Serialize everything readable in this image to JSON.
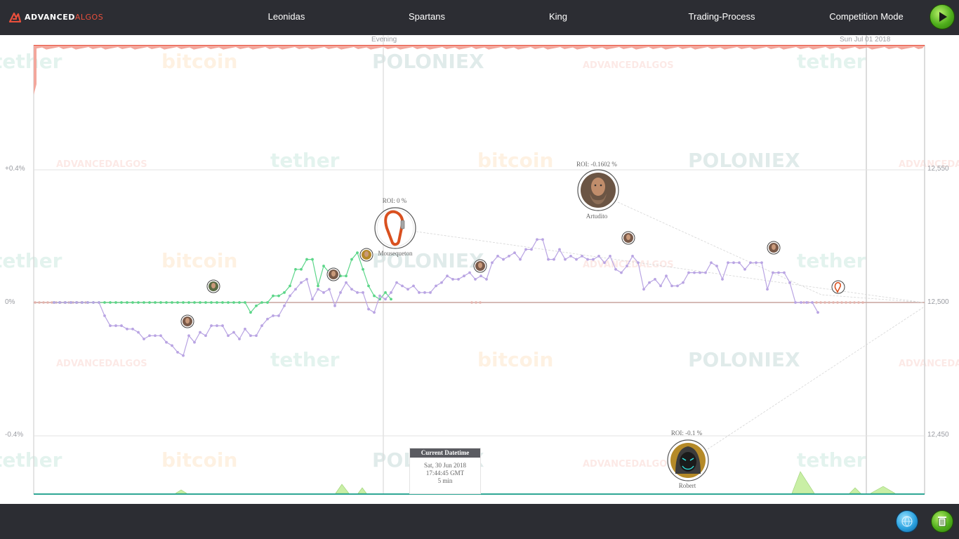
{
  "app": {
    "logo": {
      "part1": "ADVANCED",
      "part2": "ALGOS"
    },
    "nav": [
      {
        "label": "Leonidas"
      },
      {
        "label": "Spartans"
      },
      {
        "label": "King"
      },
      {
        "label": "Trading-Process"
      },
      {
        "label": "Competition Mode"
      }
    ],
    "play_icon": "play-icon",
    "bottom_buttons": [
      {
        "icon": "globe-icon"
      },
      {
        "icon": "trash-icon"
      }
    ],
    "colors": {
      "bar": "#2c2d33",
      "accent": "#e94f3c",
      "roi_line": "#b9a4e3",
      "green": "#5cd689",
      "baseline": "#c9a49e"
    }
  },
  "time_labels": {
    "period": "Evening",
    "date": "Sun Jul 01 2018"
  },
  "left_axis": [
    "+0.4%",
    "0%",
    "-0.4%"
  ],
  "right_axis": [
    "12,550",
    "12,500",
    "12,450"
  ],
  "current_datetime": {
    "title": "Current Datetime",
    "date": "Sat, 30 Jun 2018",
    "time": "17:44:45 GMT",
    "interval": "5 min"
  },
  "bots": [
    {
      "roi": "ROI: 0 %",
      "name": "Mousequeton",
      "icon": "carabiner-icon"
    },
    {
      "roi": "ROI: -0.1602 %",
      "name": "Artudito",
      "icon": "viking-avatar-icon"
    },
    {
      "roi": "ROI: -0.1 %",
      "name": "Robert",
      "icon": "hooded-mask-avatar-icon"
    }
  ],
  "watermarks": {
    "bitcoin": "bitcoin",
    "tether": "tether",
    "poloniex": "POLONIEX",
    "advanced": "ADVANCED",
    "algos": "ALGOS"
  },
  "chart_data": {
    "type": "line",
    "left_axis_ticks": [
      "+0.4%",
      "0%",
      "-0.4%"
    ],
    "right_axis_ticks": [
      12550,
      12500,
      12450
    ],
    "series": [
      {
        "name": "",
        "color": "#b9a4e3",
        "values": [
          0,
          0,
          0,
          0,
          0,
          0,
          0,
          0,
          0,
          -0.04,
          -0.07,
          -0.07,
          -0.07,
          -0.08,
          -0.08,
          -0.09,
          -0.11,
          -0.1,
          -0.1,
          -0.1,
          -0.12,
          -0.13,
          -0.15,
          -0.16,
          -0.1,
          -0.12,
          -0.09,
          -0.1,
          -0.07,
          -0.07,
          -0.07,
          -0.1,
          -0.09,
          -0.11,
          -0.08,
          -0.1,
          -0.1,
          -0.07,
          -0.05,
          -0.04,
          -0.04,
          -0.01,
          0.02,
          0.04,
          0.06,
          0.07,
          0.01,
          0.04,
          0.03,
          0.04,
          -0.01,
          0.03,
          0.06,
          0.04,
          0.03,
          0.03,
          -0.02,
          -0.03,
          0.02,
          0.01,
          0.03,
          0.06,
          0.05,
          0.04,
          0.05,
          0.03,
          0.03,
          0.03,
          0.05,
          0.06,
          0.08,
          0.07,
          0.07,
          0.08,
          0.09,
          0.07,
          0.08,
          0.07,
          0.12,
          0.14,
          0.13,
          0.14,
          0.15,
          0.13,
          0.16,
          0.16,
          0.19,
          0.19,
          0.13,
          0.13,
          0.16,
          0.13,
          0.14,
          0.13,
          0.14,
          0.13,
          0.13,
          0.14,
          0.12,
          0.14,
          0.1,
          0.09,
          0.11,
          0.14,
          0.12,
          0.04,
          0.06,
          0.07,
          0.05,
          0.08,
          0.05,
          0.05,
          0.06,
          0.09,
          0.09,
          0.09,
          0.09,
          0.12,
          0.11,
          0.07,
          0.12,
          0.12,
          0.12,
          0.1,
          0.12,
          0.12,
          0.12,
          0.04,
          0.09,
          0.09,
          0.09,
          0.06,
          0,
          0,
          0,
          0,
          -0.03
        ]
      },
      {
        "name": "",
        "color": "#5cd689",
        "values": [
          0,
          0,
          0,
          0,
          0,
          0,
          0,
          0,
          0,
          0,
          0,
          0,
          0,
          0,
          0,
          0,
          0,
          0,
          0,
          0,
          0,
          0,
          0,
          0,
          0,
          0,
          0,
          0,
          0,
          0,
          0,
          0,
          0,
          0,
          0,
          -0.03,
          -0.01,
          0,
          0,
          0.02,
          0.02,
          0.03,
          0.05,
          0.1,
          0.1,
          0.13,
          0.13,
          0.05,
          0.11,
          0.09,
          0.1,
          0.08,
          0.08,
          0.13,
          0.15,
          0.1,
          0.05,
          0.02,
          0.01,
          0.03,
          0.01
        ]
      }
    ]
  }
}
